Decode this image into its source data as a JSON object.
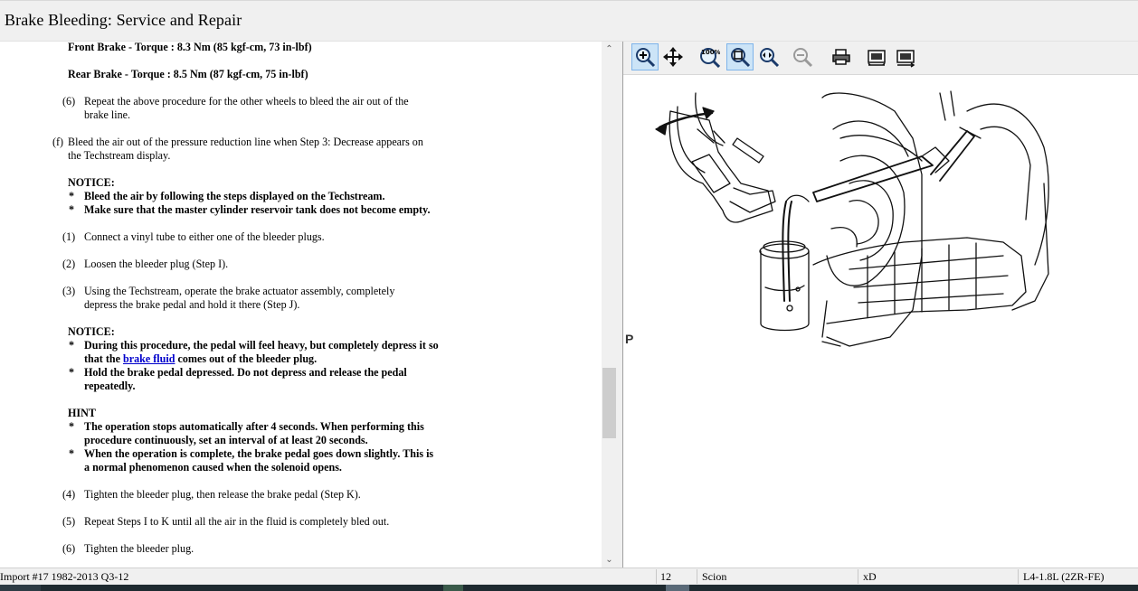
{
  "window": {
    "title": "Brake Bleeding:  Service and Repair"
  },
  "procedure": {
    "torque_front": "Front Brake - Torque : 8.3 Nm (85 kgf-cm, 73 in-lbf)",
    "torque_rear": "Rear Brake - Torque : 8.5 Nm (87 kgf-cm, 75 in-lbf)",
    "step6a_num": "(6)",
    "step6a_line1": "Repeat the above procedure for the other wheels to bleed the air out of the",
    "step6a_line2": "brake line.",
    "stepf_num": "(f)",
    "stepf_line1": "Bleed the air out of the pressure reduction line when Step 3: Decrease appears on",
    "stepf_line2": "the Techstream display.",
    "notice1_title": "NOTICE:",
    "notice1_b1": "Bleed the air by following the steps displayed on the Techstream.",
    "notice1_b2": "Make sure that the master cylinder reservoir tank does not become empty.",
    "step1_num": "(1)",
    "step1": "Connect a vinyl tube to either one of the bleeder plugs.",
    "step2_num": "(2)",
    "step2": "Loosen the bleeder plug (Step I).",
    "step3_num": "(3)",
    "step3_line1": "Using the Techstream, operate the brake actuator assembly, completely",
    "step3_line2": "depress the brake pedal and hold it there (Step J).",
    "notice2_title": "NOTICE:",
    "notice2_b1_line1": "During this procedure, the pedal will feel heavy, but completely depress it so",
    "notice2_b1_pre": "that the ",
    "notice2_b1_link": "brake fluid",
    "notice2_b1_post": " comes out of the bleeder plug.",
    "notice2_b2_line1": "Hold the brake pedal depressed. Do not depress and release the pedal",
    "notice2_b2_line2": "repeatedly.",
    "hint_title": "HINT",
    "hint_b1_line1": "The operation stops automatically after 4 seconds. When performing this",
    "hint_b1_line2": "procedure continuously, set an interval of at least 20 seconds.",
    "hint_b2_line1": "When the operation is complete, the brake pedal goes down slightly. This is",
    "hint_b2_line2": "a normal phenomenon caused when the solenoid opens.",
    "step4_num": "(4)",
    "step4": "Tighten the bleeder plug, then release the brake pedal (Step K).",
    "step5_num": "(5)",
    "step5": "Repeat Steps I to K until all the air in the fluid is completely bled out.",
    "step6b_num": "(6)",
    "step6b": "Tighten the bleeder plug.",
    "bullet": "*"
  },
  "viewer": {
    "toolbar_icons": [
      "zoom-in-icon",
      "pan-icon",
      "zoom-100-icon",
      "zoom-fit-icon",
      "zoom-width-icon",
      "zoom-out-icon",
      "print-icon",
      "copy-image-icon",
      "export-image-icon"
    ],
    "zoom_100_text": "100%",
    "figure_label": "P"
  },
  "status": {
    "source": "Import #17 1982-2013 Q3-12",
    "page": "12",
    "make": "Scion",
    "model": "xD",
    "engine": "L4-1.8L (2ZR-FE)"
  },
  "colors": {
    "link": "#0000cc",
    "active_button": "#cce4f7",
    "taskbar": "#1e2a30"
  }
}
